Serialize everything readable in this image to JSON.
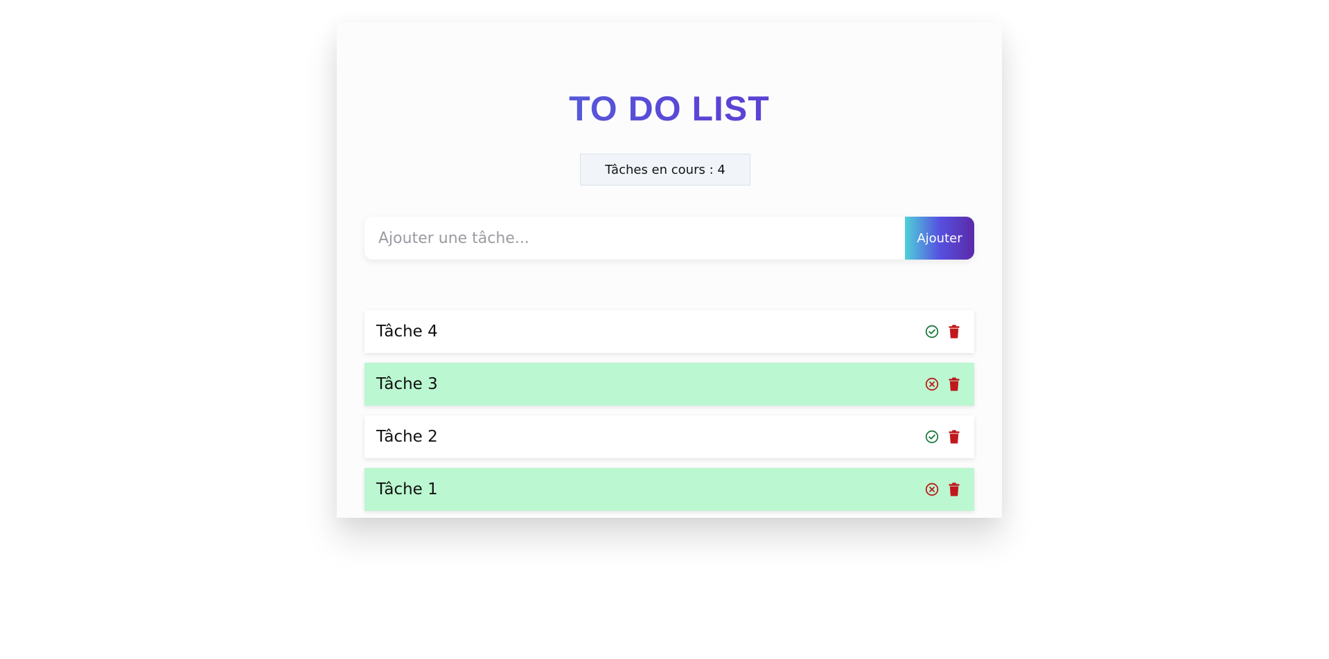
{
  "app": {
    "title": "TO DO LIST",
    "counter_text": "Tâches en cours : 4"
  },
  "add_form": {
    "placeholder": "Ajouter une tâche...",
    "button_label": "Ajouter"
  },
  "colors": {
    "accent_start": "#4fd1d9",
    "accent_mid": "#5650e0",
    "accent_end": "#5b2aa8",
    "done_background": "#bbf7d0",
    "check_icon": "#1f7a3f",
    "cancel_icon": "#b91c1c",
    "trash_icon": "#c0181c"
  },
  "tasks": [
    {
      "label": "Tâche 4",
      "completed": false,
      "toggle_icon": "check-circle-icon",
      "delete_icon": "trash-icon"
    },
    {
      "label": "Tâche 3",
      "completed": true,
      "toggle_icon": "cross-circle-icon",
      "delete_icon": "trash-icon"
    },
    {
      "label": "Tâche 2",
      "completed": false,
      "toggle_icon": "check-circle-icon",
      "delete_icon": "trash-icon"
    },
    {
      "label": "Tâche 1",
      "completed": true,
      "toggle_icon": "cross-circle-icon",
      "delete_icon": "trash-icon"
    }
  ]
}
